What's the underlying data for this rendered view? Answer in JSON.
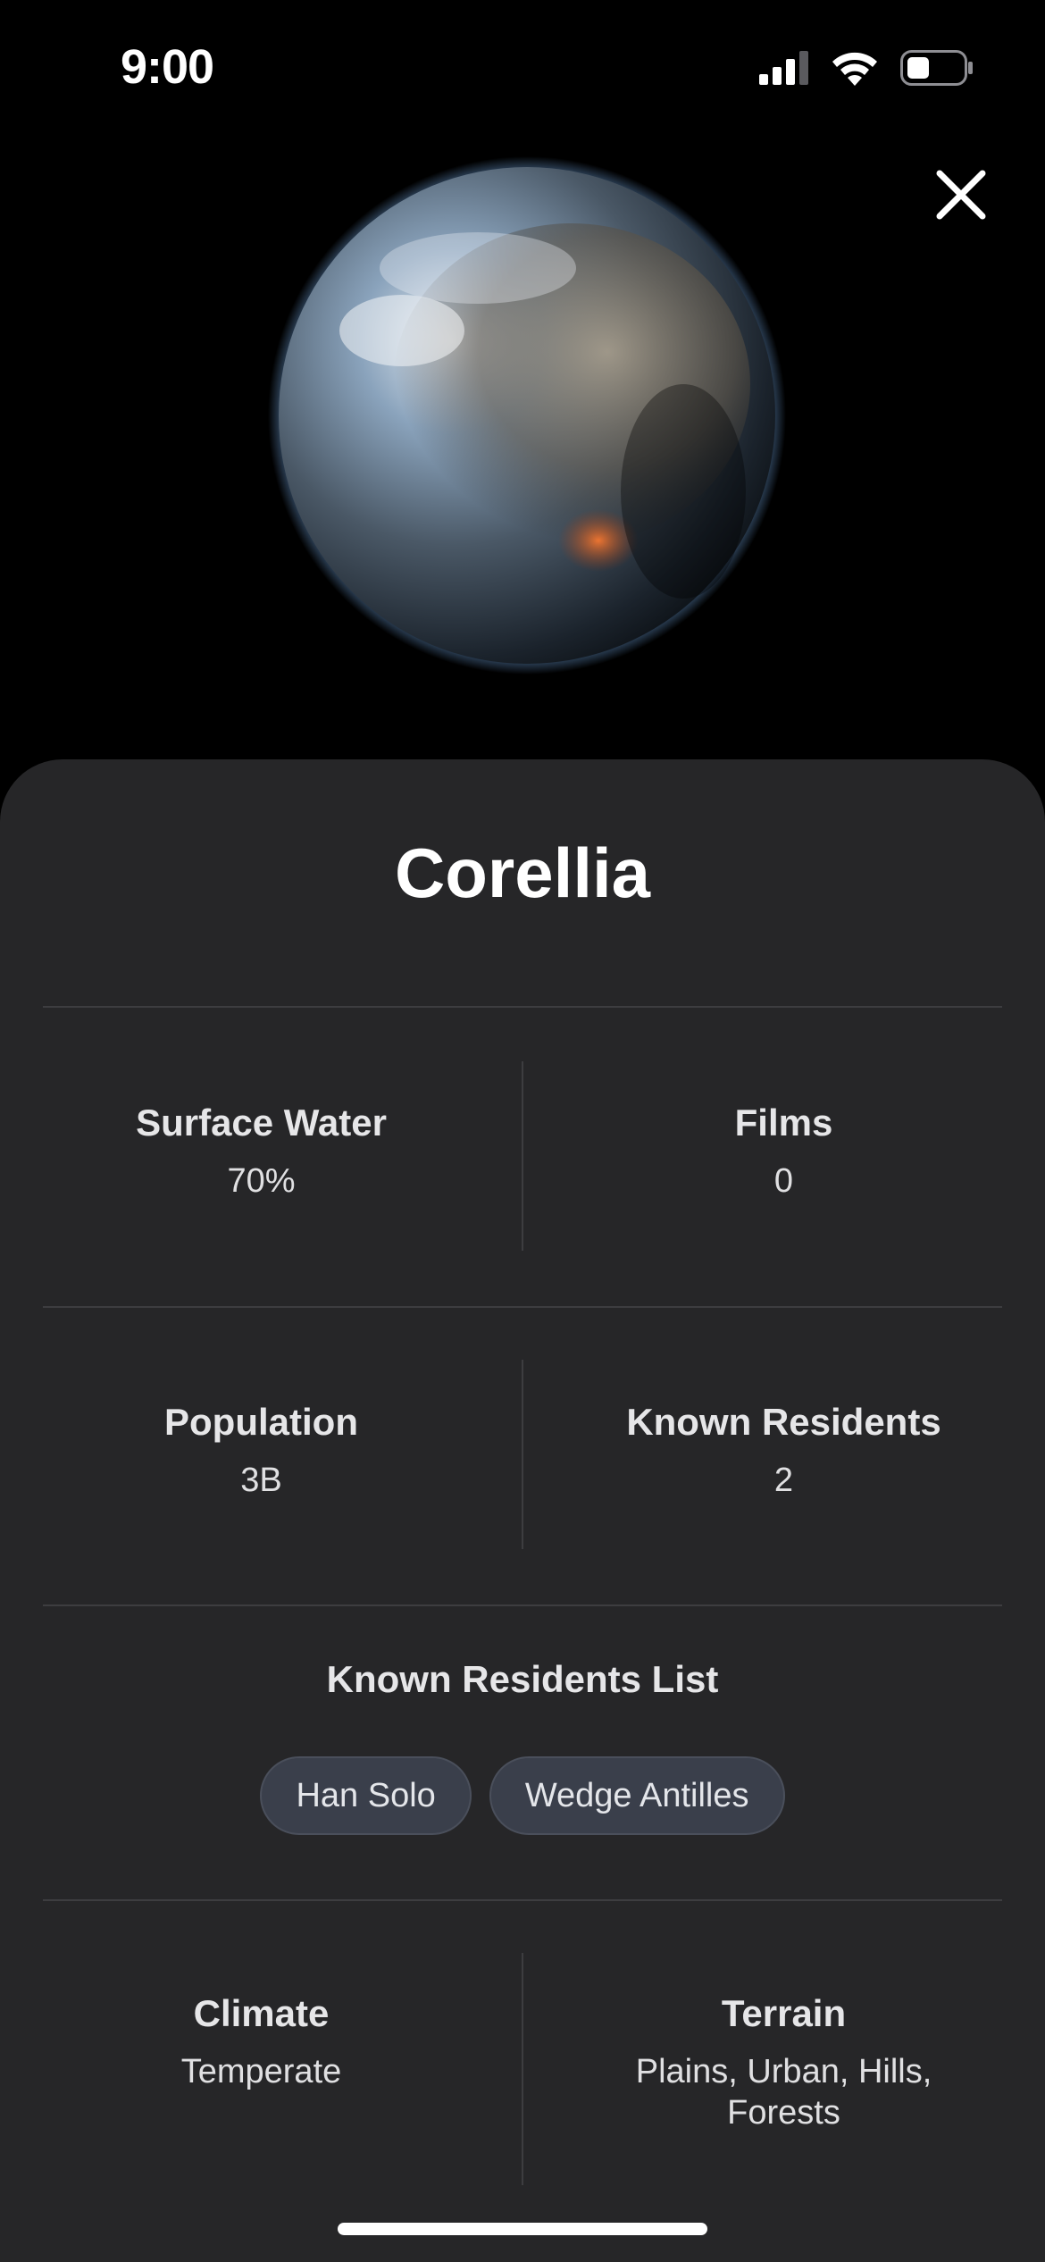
{
  "status_bar": {
    "time": "9:00",
    "icons": [
      "cellular-signal-icon",
      "wifi-icon",
      "battery-icon"
    ]
  },
  "header": {
    "close_icon": "close-icon"
  },
  "planet": {
    "name": "Corellia",
    "image": "planet-image"
  },
  "stats": {
    "surface_water": {
      "label": "Surface Water",
      "value": "70%"
    },
    "films": {
      "label": "Films",
      "value": "0"
    },
    "population": {
      "label": "Population",
      "value": "3B"
    },
    "known_residents": {
      "label": "Known Residents",
      "value": "2"
    }
  },
  "residents": {
    "title": "Known Residents List",
    "items": [
      "Han Solo",
      "Wedge Antilles"
    ]
  },
  "details": {
    "climate": {
      "label": "Climate",
      "value": "Temperate"
    },
    "terrain": {
      "label": "Terrain",
      "value": "Plains, Urban, Hills, Forests"
    }
  },
  "colors": {
    "background": "#000000",
    "sheet": "#262628",
    "divider": "#3d3d40",
    "chip_bg": "#3a3f4b"
  }
}
